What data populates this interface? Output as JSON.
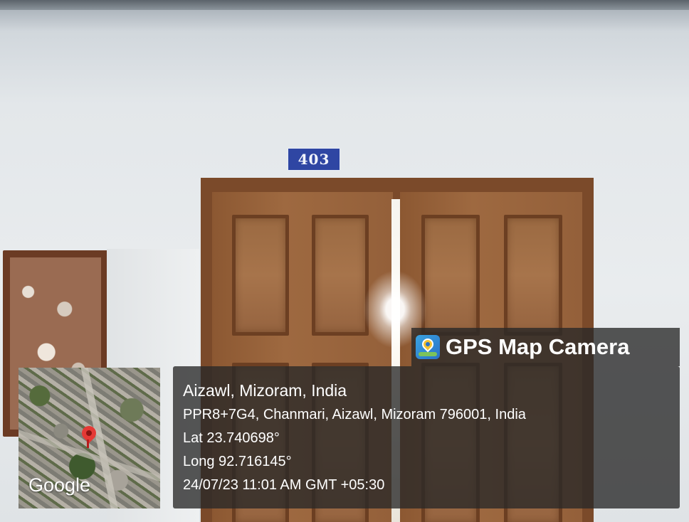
{
  "room_number": "403",
  "brand": {
    "app_name": "GPS Map Camera",
    "icon": "gps-map-camera-logo-icon"
  },
  "map": {
    "provider_label": "Google",
    "pin_icon": "map-pin-icon"
  },
  "location": {
    "title": "Aizawl, Mizoram, India",
    "address": "PPR8+7G4, Chanmari, Aizawl, Mizoram 796001, India",
    "latitude": "Lat 23.740698°",
    "longitude": "Long 92.716145°",
    "timestamp": "24/07/23 11:01 AM GMT +05:30"
  },
  "colors": {
    "overlay_bg": "#282828",
    "overlay_text": "#ffffff",
    "room_plate": "#2f46a3",
    "door_wood": "#9e6940"
  }
}
